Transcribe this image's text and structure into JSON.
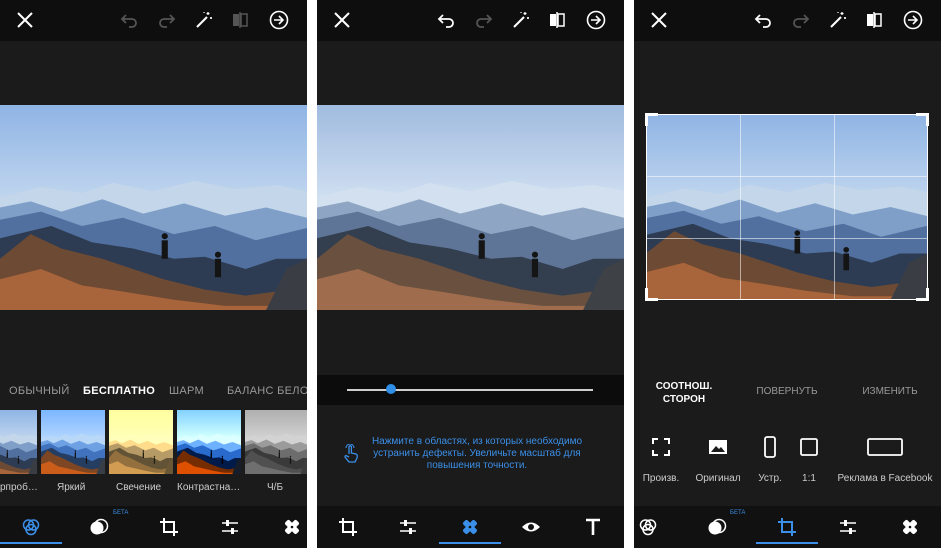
{
  "panel1": {
    "filter_tabs": [
      "ОБЫЧНЫЙ",
      "БЕСПЛАТНО",
      "ШАРМ",
      "БАЛАНС БЕЛОГО"
    ],
    "selected_tab": "БЕСПЛАТНО",
    "filters": [
      "рпроб…",
      "Яркий",
      "Свечение",
      "Контрастна…",
      "Ч/Б"
    ],
    "beta": "БЕТА"
  },
  "panel2": {
    "slider_value": 0.18,
    "hint": "Нажмите в областях, из которых необходимо устранить дефекты. Увеличьте масштаб для повышения точности."
  },
  "panel3": {
    "tabs": [
      "СООТНОШ. СТОРОН",
      "ПОВЕРНУТЬ",
      "ИЗМЕНИТЬ"
    ],
    "selected_tab": "СООТНОШ. СТОРОН",
    "ratios": [
      "Произв.",
      "Оригинал",
      "Устр.",
      "1:1",
      "Реклама в Facebook"
    ],
    "beta": "БЕТА"
  },
  "colors": {
    "accent": "#3b8fe8",
    "background": "#1b1b1b",
    "bar": "#111111"
  }
}
